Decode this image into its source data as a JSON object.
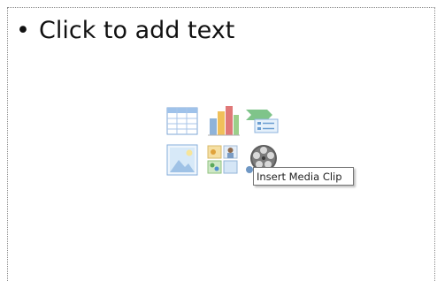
{
  "slide": {
    "bullet": "•",
    "placeholder_text": "Click to add text"
  },
  "content_icons": [
    {
      "icon": "insert-table-icon"
    },
    {
      "icon": "insert-chart-icon"
    },
    {
      "icon": "insert-smartart-icon"
    },
    {
      "icon": "insert-picture-icon"
    },
    {
      "icon": "insert-clip-art-icon"
    },
    {
      "icon": "insert-media-clip-icon"
    }
  ],
  "tooltip": {
    "text": "Insert Media Clip"
  }
}
